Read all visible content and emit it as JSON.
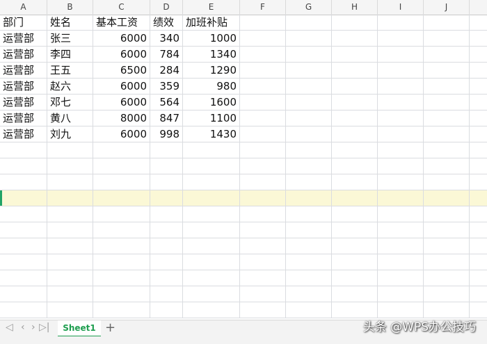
{
  "columns": [
    "A",
    "B",
    "C",
    "D",
    "E",
    "F",
    "G",
    "H",
    "I",
    "J"
  ],
  "table": {
    "headers": [
      "部门",
      "姓名",
      "基本工资",
      "绩效",
      "加班补贴"
    ],
    "rows": [
      [
        "运营部",
        "张三",
        "6000",
        "340",
        "1000"
      ],
      [
        "运营部",
        "李四",
        "6000",
        "784",
        "1340"
      ],
      [
        "运营部",
        "王五",
        "6500",
        "284",
        "1290"
      ],
      [
        "运营部",
        "赵六",
        "6000",
        "359",
        "980"
      ],
      [
        "运营部",
        "邓七",
        "6000",
        "564",
        "1600"
      ],
      [
        "运营部",
        "黄八",
        "8000",
        "847",
        "1100"
      ],
      [
        "运营部",
        "刘九",
        "6000",
        "998",
        "1430"
      ]
    ]
  },
  "tabbar": {
    "first": "◁",
    "prev": "‹",
    "next": "›",
    "last": "▷|",
    "sheet_name": "Sheet1",
    "add": "+"
  },
  "watermark": "头条 @WPS办公技巧",
  "colors": {
    "accent": "#1e9e4f",
    "highlight_row": "#fbf8d6"
  }
}
